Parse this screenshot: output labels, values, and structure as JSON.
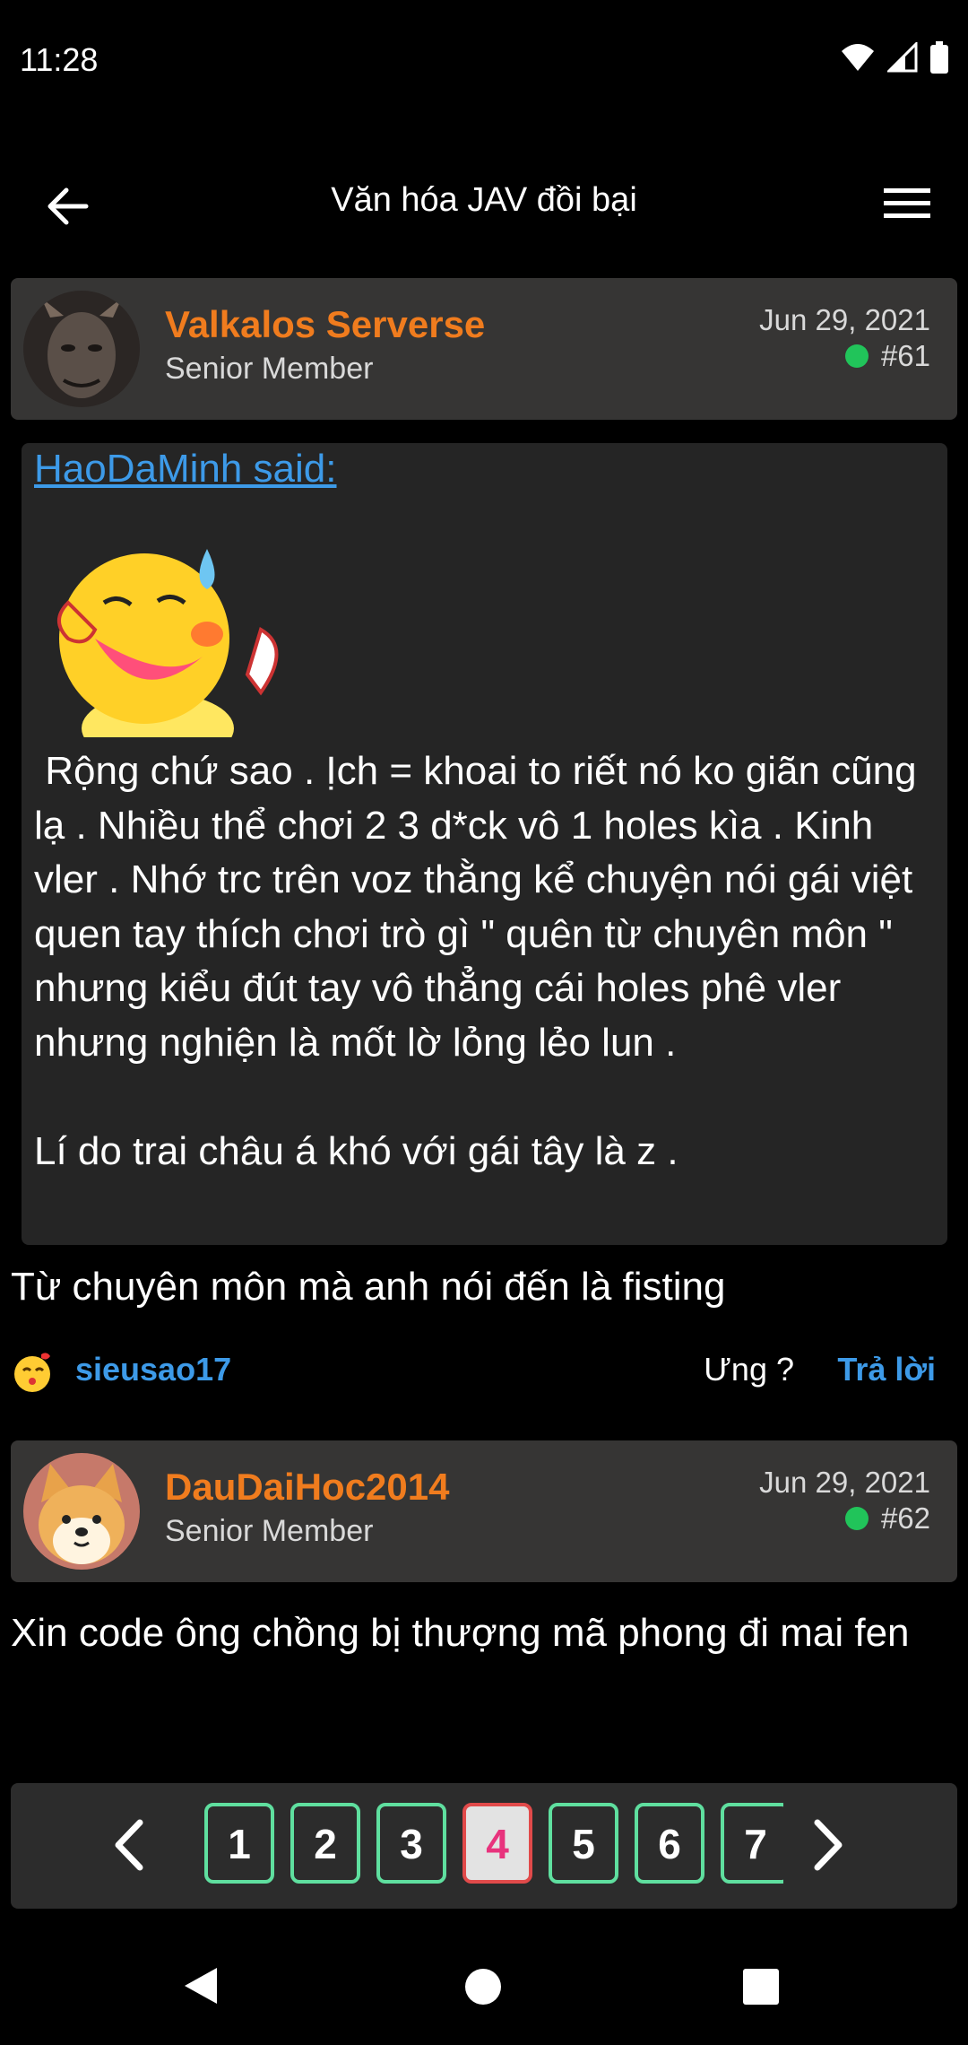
{
  "status_bar": {
    "time": "11:28",
    "icons": [
      "wifi-icon",
      "signal-icon",
      "battery-icon"
    ]
  },
  "app_bar": {
    "title": "Văn hóa JAV đồi bại",
    "back_icon": "arrow-left-icon",
    "menu_icon": "hamburger-menu-icon"
  },
  "posts": [
    {
      "username": "Valkalos Serverse",
      "role": "Senior Member",
      "date": "Jun 29, 2021",
      "number": "#61",
      "quote": {
        "author": "HaoDaMinh said:",
        "text": " Rộng chứ sao . Ịch = khoai to riết nó ko giãn cũng lạ . Nhiều thể chơi 2 3 d*ck vô 1 holes kìa . Kinh vler . Nhớ trc trên voz thằng kể chuyện nói gái việt quen tay thích chơi trò gì \" quên từ chuyên môn \" nhưng kiểu đút tay vô thẳng cái holes phê vler nhưng nghiện là mốt lờ lỏng lẻo lun .\n\nLí do trai châu á khó với gái tây là z ."
      },
      "body": "Từ chuyên môn mà anh nói đến là fisting",
      "reactions": {
        "user": "sieusao17",
        "react_label": "Ưng ?",
        "reply_label": "Trả lời"
      }
    },
    {
      "username": "DauDaiHoc2014",
      "role": "Senior Member",
      "date": "Jun 29, 2021",
      "number": "#62",
      "body": "Xin code ông chồng bị thượng mã phong đi mai fen"
    }
  ],
  "pagination": {
    "pages": [
      "1",
      "2",
      "3",
      "4",
      "5",
      "6",
      "7"
    ],
    "current": "4"
  },
  "colors": {
    "accent_orange": "#f07c1e",
    "link_blue": "#3d9ae8",
    "online_green": "#21c45a",
    "page_border": "#5fdf9f",
    "active_page": "#e8337d"
  }
}
